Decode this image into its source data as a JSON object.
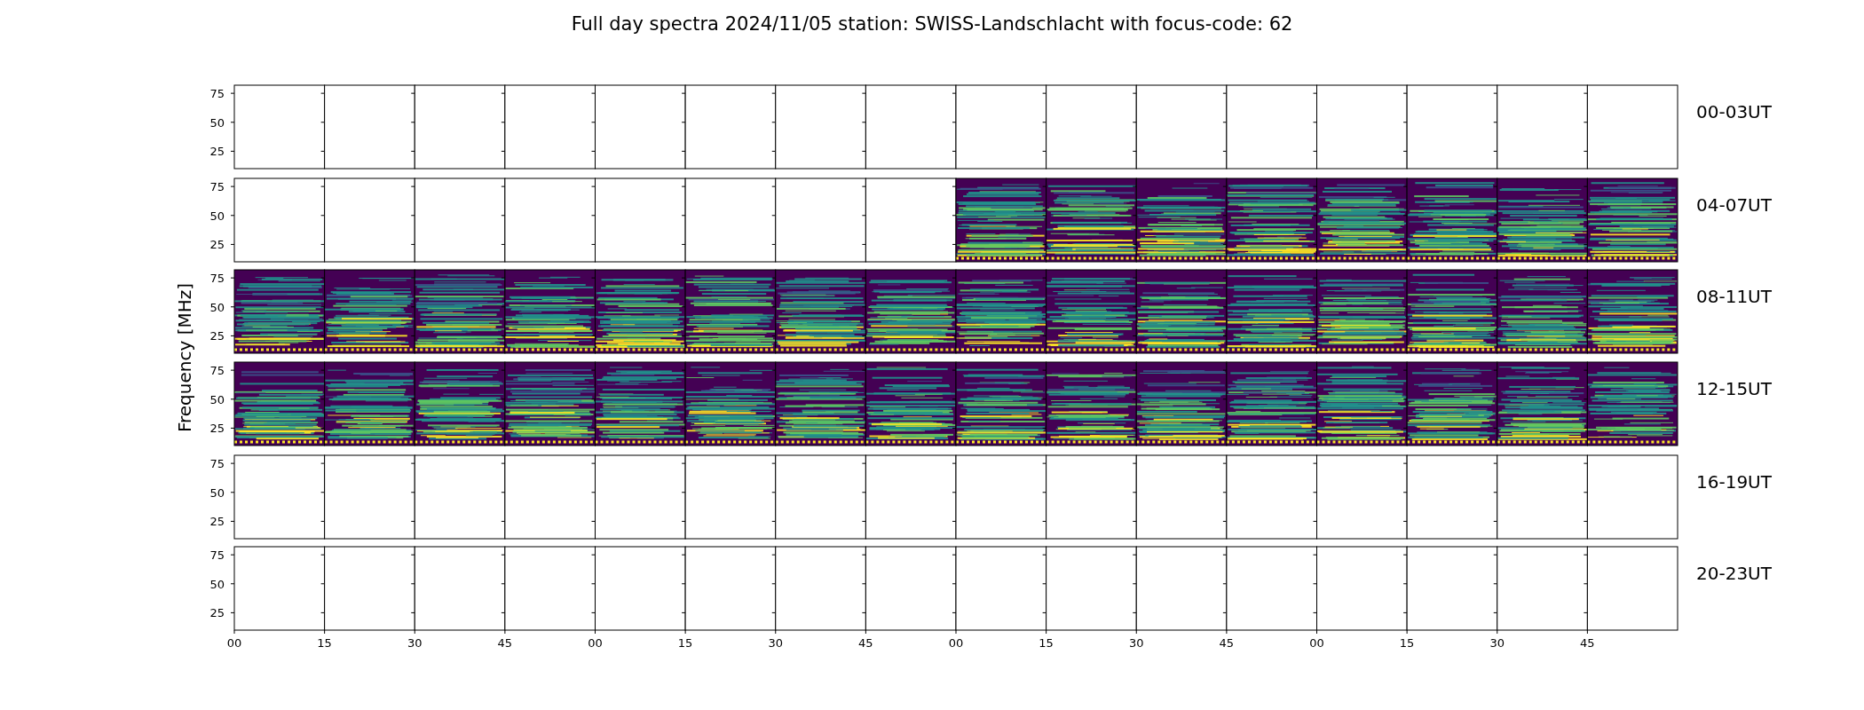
{
  "title": "Full day spectra 2024/11/05 station: SWISS-Landschlacht with focus-code: 62",
  "y_label": "Frequency [MHz]",
  "x_ticks": [
    "00",
    "15",
    "30",
    "45",
    "00",
    "15",
    "30",
    "45",
    "00",
    "15",
    "30",
    "45",
    "00",
    "15",
    "30",
    "45"
  ],
  "rows": [
    {
      "label": "00-03UT",
      "y_ticks": [
        "75",
        "50",
        "25"
      ],
      "panels": [
        {
          "has_data": false
        },
        {
          "has_data": false
        },
        {
          "has_data": false
        },
        {
          "has_data": false
        },
        {
          "has_data": false
        },
        {
          "has_data": false
        },
        {
          "has_data": false
        },
        {
          "has_data": false
        },
        {
          "has_data": false
        },
        {
          "has_data": false
        },
        {
          "has_data": false
        },
        {
          "has_data": false
        },
        {
          "has_data": false
        },
        {
          "has_data": false
        },
        {
          "has_data": false
        },
        {
          "has_data": false
        }
      ]
    },
    {
      "label": "04-07UT",
      "y_ticks": [
        "75",
        "50",
        "25"
      ],
      "panels": [
        {
          "has_data": false
        },
        {
          "has_data": false
        },
        {
          "has_data": false
        },
        {
          "has_data": false
        },
        {
          "has_data": false
        },
        {
          "has_data": false
        },
        {
          "has_data": false
        },
        {
          "has_data": false
        },
        {
          "has_data": true
        },
        {
          "has_data": true
        },
        {
          "has_data": true
        },
        {
          "has_data": true
        },
        {
          "has_data": true
        },
        {
          "has_data": true
        },
        {
          "has_data": true
        },
        {
          "has_data": true
        }
      ]
    },
    {
      "label": "08-11UT",
      "y_ticks": [
        "75",
        "50",
        "25"
      ],
      "panels": [
        {
          "has_data": true
        },
        {
          "has_data": true
        },
        {
          "has_data": true
        },
        {
          "has_data": true
        },
        {
          "has_data": true
        },
        {
          "has_data": true
        },
        {
          "has_data": true
        },
        {
          "has_data": true
        },
        {
          "has_data": true
        },
        {
          "has_data": true
        },
        {
          "has_data": true
        },
        {
          "has_data": true
        },
        {
          "has_data": true
        },
        {
          "has_data": true
        },
        {
          "has_data": true
        },
        {
          "has_data": true
        }
      ]
    },
    {
      "label": "12-15UT",
      "y_ticks": [
        "75",
        "50",
        "25"
      ],
      "panels": [
        {
          "has_data": true
        },
        {
          "has_data": true
        },
        {
          "has_data": true
        },
        {
          "has_data": true
        },
        {
          "has_data": true
        },
        {
          "has_data": true
        },
        {
          "has_data": true
        },
        {
          "has_data": true
        },
        {
          "has_data": true
        },
        {
          "has_data": true
        },
        {
          "has_data": true
        },
        {
          "has_data": true
        },
        {
          "has_data": true
        },
        {
          "has_data": true
        },
        {
          "has_data": true
        },
        {
          "has_data": true
        }
      ]
    },
    {
      "label": "16-19UT",
      "y_ticks": [
        "75",
        "50",
        "25"
      ],
      "panels": [
        {
          "has_data": false
        },
        {
          "has_data": false
        },
        {
          "has_data": false
        },
        {
          "has_data": false
        },
        {
          "has_data": false
        },
        {
          "has_data": false
        },
        {
          "has_data": false
        },
        {
          "has_data": false
        },
        {
          "has_data": false
        },
        {
          "has_data": false
        },
        {
          "has_data": false
        },
        {
          "has_data": false
        },
        {
          "has_data": false
        },
        {
          "has_data": false
        },
        {
          "has_data": false
        },
        {
          "has_data": false
        }
      ]
    },
    {
      "label": "20-23UT",
      "y_ticks": [
        "75",
        "50",
        "25"
      ],
      "panels": [
        {
          "has_data": false
        },
        {
          "has_data": false
        },
        {
          "has_data": false
        },
        {
          "has_data": false
        },
        {
          "has_data": false
        },
        {
          "has_data": false
        },
        {
          "has_data": false
        },
        {
          "has_data": false
        },
        {
          "has_data": false
        },
        {
          "has_data": false
        },
        {
          "has_data": false
        },
        {
          "has_data": false
        },
        {
          "has_data": false
        },
        {
          "has_data": false
        },
        {
          "has_data": false
        },
        {
          "has_data": false
        }
      ]
    }
  ]
}
